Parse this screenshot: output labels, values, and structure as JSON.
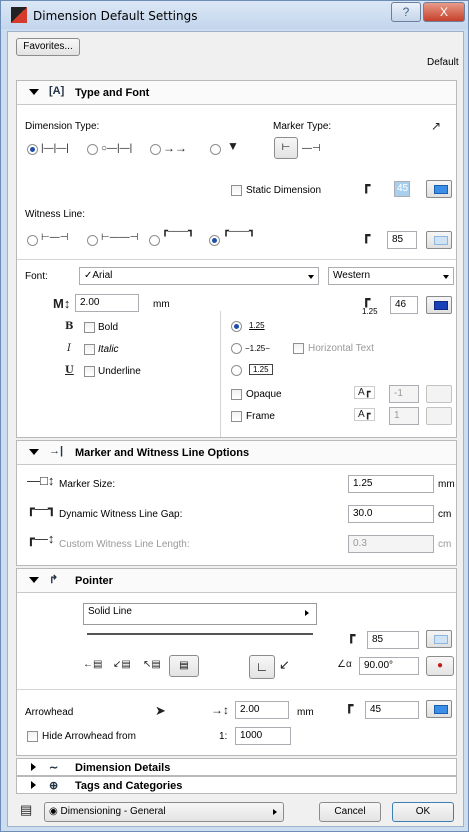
{
  "window": {
    "title": "Dimension Default Settings",
    "help_label": "?",
    "close_label": "X"
  },
  "top": {
    "favorites_label": "Favorites...",
    "default_label": "Default"
  },
  "type_font": {
    "title": "Type and Font",
    "dimension_type_label": "Dimension Type:",
    "marker_type_label": "Marker Type:",
    "static_dimension_label": "Static Dimension",
    "witness_line_label": "Witness Line:",
    "pen_a": "45",
    "pen_b": "85",
    "font_label": "Font:",
    "font_value": "✓Arial",
    "script_value": "Western",
    "size_value": "2.00",
    "size_unit": "mm",
    "pen_c": "46",
    "bold_label": "Bold",
    "italic_label": "Italic",
    "underline_label": "Underline",
    "opt1": "1.25",
    "opt2": "−1.25−",
    "opt3": "1.25",
    "horizontal_text_label": "Horizontal Text",
    "opaque_label": "Opaque",
    "frame_label": "Frame",
    "opaque_pen": "-1",
    "frame_pen": "1",
    "pen_height_label": "1.25"
  },
  "marker": {
    "title": "Marker and Witness Line Options",
    "marker_size_label": "Marker Size:",
    "marker_size_value": "1.25",
    "marker_size_unit": "mm",
    "gap_label": "Dynamic Witness Line Gap:",
    "gap_value": "30.0",
    "gap_unit": "cm",
    "custom_label": "Custom Witness Line Length:",
    "custom_value": "0.3",
    "custom_unit": "cm"
  },
  "pointer": {
    "title": "Pointer",
    "line_type": "Solid Line",
    "pen_value": "85",
    "angle_value": "90.00°",
    "arrowhead_label": "Arrowhead",
    "arrow_size_value": "2.00",
    "arrow_size_unit": "mm",
    "arrow_pen": "45",
    "hide_arrowhead_label": "Hide Arrowhead from",
    "scale_prefix": "1:",
    "scale_value": "1000"
  },
  "sections": {
    "dimension_details": "Dimension Details",
    "tags_categories": "Tags and Categories"
  },
  "footer": {
    "layer_value": "Dimensioning - General",
    "cancel_label": "Cancel",
    "ok_label": "OK"
  }
}
